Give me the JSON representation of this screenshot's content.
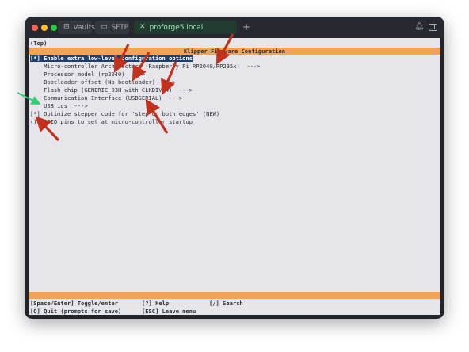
{
  "titlebar": {
    "tabs": [
      {
        "label": "Vaults",
        "icon": "vault-icon"
      },
      {
        "label": "SFTP",
        "icon": "folder-icon"
      },
      {
        "label": "proforge5.local",
        "icon": "close-icon"
      }
    ],
    "new_tab_glyph": "+"
  },
  "terminal": {
    "top_label": "(Top)",
    "config_title": "Klipper Firmware Configuration",
    "menu": [
      "[*] Enable extra low-level configuration options",
      "    Micro-controller Architecture (Raspberry Pi RP2040/RP235x)  --->",
      "    Processor model (rp2040)  --->",
      "    Bootloader offset (No bootloader)  --->",
      "    Flash chip (GENERIC_03H with CLKDIV 4)  --->",
      "    Communication Interface (USBSERIAL)  --->",
      "    USB ids  --->",
      "[*] Optimize stepper code for 'step on both edges' (NEW)",
      "()  GPIO pins to set at micro-controller startup"
    ],
    "footer": {
      "toggle": "[Space/Enter] Toggle/enter",
      "help": "[?] Help",
      "search": "[/] Search",
      "quit": "[Q] Quit (prompts for save)",
      "leave": "[ESC] Leave menu"
    }
  },
  "colors": {
    "accent_bar": "#f0a45a",
    "selection": "#1e3f6e",
    "annotation_arrow_red": "#c0311e",
    "annotation_arrow_green": "#2ecf72"
  }
}
